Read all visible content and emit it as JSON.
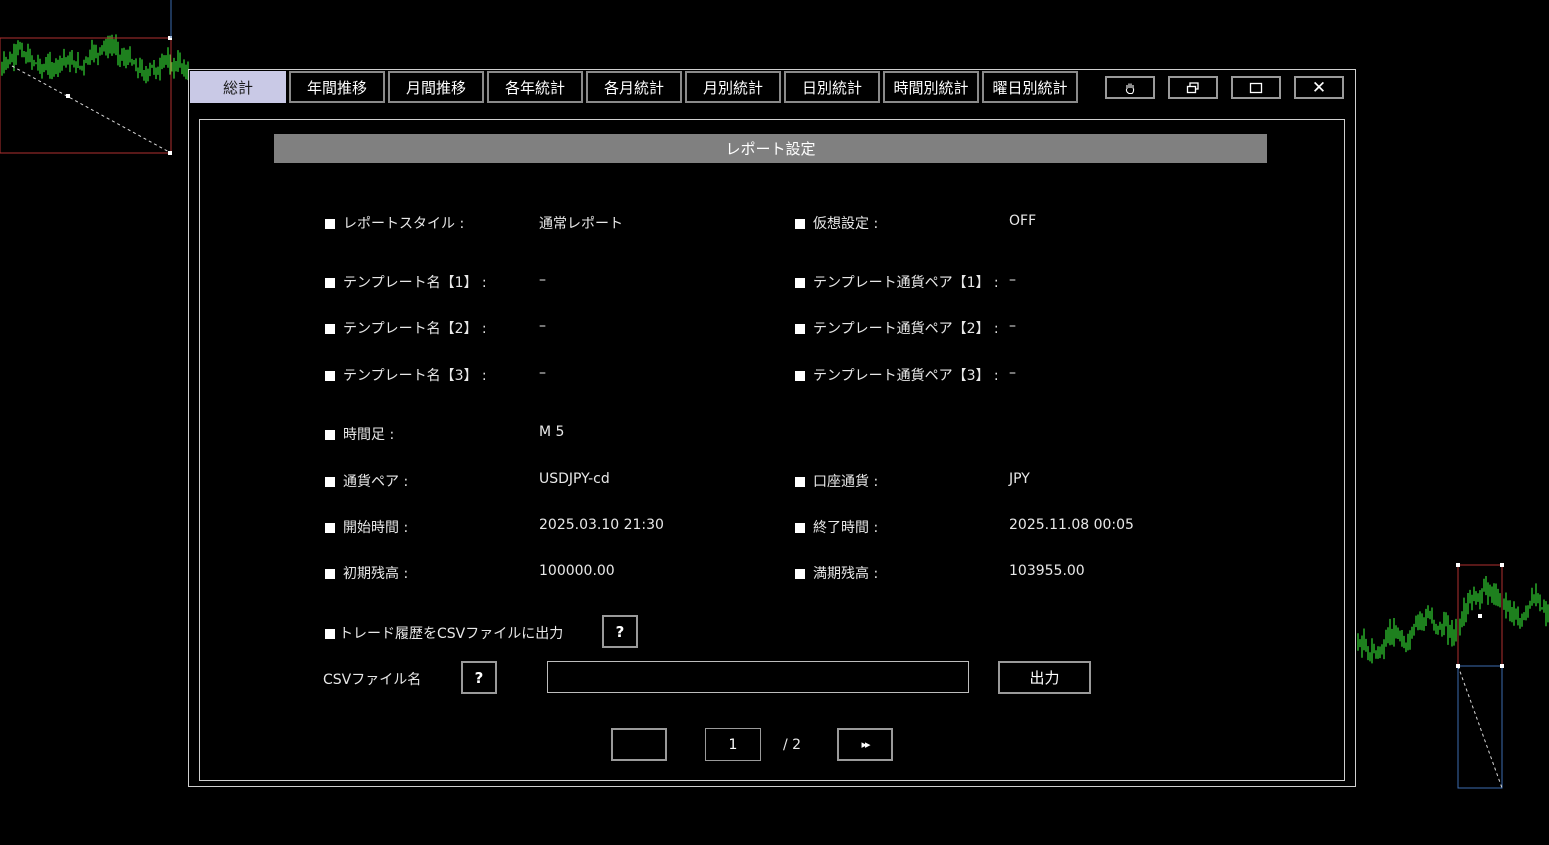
{
  "tabs": [
    {
      "label": "総計",
      "active": true
    },
    {
      "label": "年間推移"
    },
    {
      "label": "月間推移"
    },
    {
      "label": "各年統計"
    },
    {
      "label": "各月統計"
    },
    {
      "label": "月別統計"
    },
    {
      "label": "日別統計"
    },
    {
      "label": "時間別統計"
    },
    {
      "label": "曜日別統計"
    }
  ],
  "window_buttons": {
    "drag_icon": "hand-icon",
    "restore_icon": "restore-icon",
    "maximize_icon": "maximize-icon",
    "close_label": "✕"
  },
  "section_title": "レポート設定",
  "settings": {
    "report_style": {
      "label": "レポートスタイル :",
      "value": "通常レポート"
    },
    "virtual_setting": {
      "label": "仮想設定 :",
      "value": "OFF"
    },
    "template1": {
      "label": "テンプレート名【1】 :",
      "value": "–"
    },
    "template_pair1": {
      "label": "テンプレート通貨ペア【1】 :",
      "value": "–"
    },
    "template2": {
      "label": "テンプレート名【2】 :",
      "value": "–"
    },
    "template_pair2": {
      "label": "テンプレート通貨ペア【2】 :",
      "value": "–"
    },
    "template3": {
      "label": "テンプレート名【3】 :",
      "value": "–"
    },
    "template_pair3": {
      "label": "テンプレート通貨ペア【3】 :",
      "value": "–"
    },
    "timeframe": {
      "label": "時間足 :",
      "value": "M 5"
    },
    "pair": {
      "label": "通貨ペア :",
      "value": "USDJPY-cd"
    },
    "account_currency": {
      "label": "口座通貨 :",
      "value": "JPY"
    },
    "start_time": {
      "label": "開始時間 :",
      "value": "2025.03.10 21:30"
    },
    "end_time": {
      "label": "終了時間 :",
      "value": "2025.11.08 00:05"
    },
    "initial_balance": {
      "label": "初期残高 :",
      "value": "100000.00"
    },
    "final_balance": {
      "label": "満期残高 :",
      "value": "103955.00"
    }
  },
  "csv": {
    "export_label": "トレード履歴をCSVファイルに出力",
    "filename_label": "CSVファイル名",
    "help_label": "?",
    "filename_value": "",
    "output_button": "出力"
  },
  "pagination": {
    "prev_label": "",
    "current_page": "1",
    "total": "/ 2",
    "next_label": "▸▸"
  },
  "colors": {
    "candle": "#3dff3d",
    "tab_active_bg": "#c9c9e6",
    "section_bar": "#808080",
    "marker_red": "#b03030"
  }
}
